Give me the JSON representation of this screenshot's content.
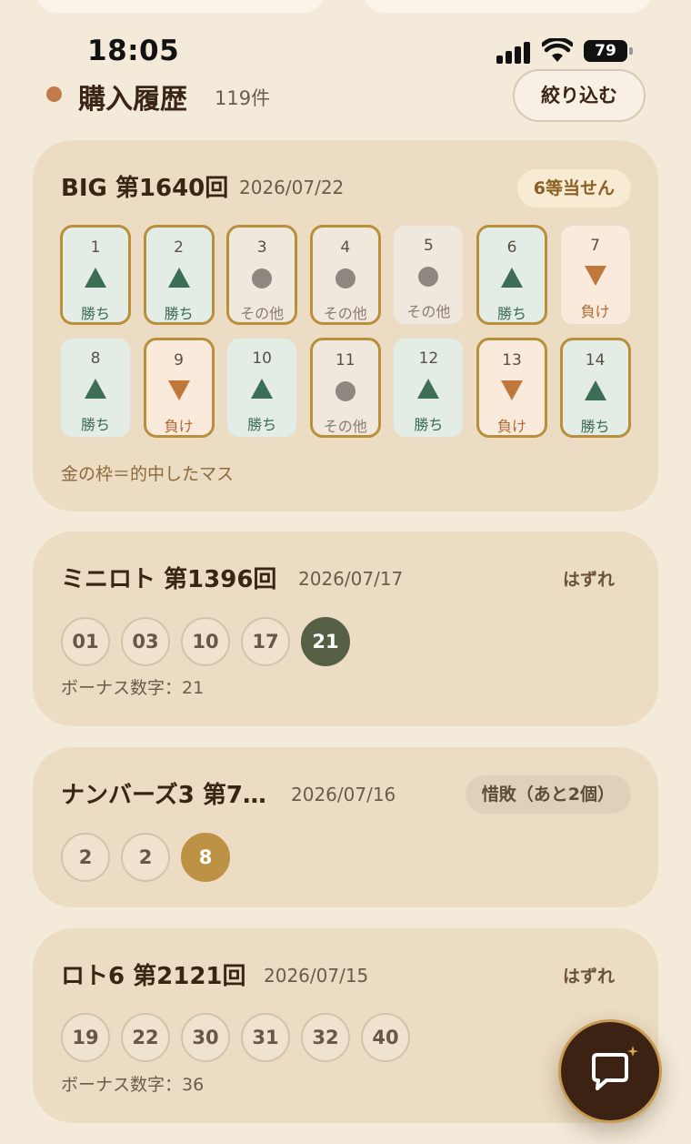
{
  "status_bar": {
    "time": "18:05",
    "battery": "79"
  },
  "header": {
    "title": "購入履歴",
    "count": "119件",
    "filter_label": "絞り込む"
  },
  "cards": [
    {
      "title": "BIG 第1640回",
      "date": "2026/07/22",
      "result": "6等当せん",
      "matches": [
        {
          "n": "1",
          "label": "勝ち",
          "kind": "win",
          "hit": true
        },
        {
          "n": "2",
          "label": "勝ち",
          "kind": "win",
          "hit": true
        },
        {
          "n": "3",
          "label": "その他",
          "kind": "other",
          "hit": true
        },
        {
          "n": "4",
          "label": "その他",
          "kind": "other",
          "hit": true
        },
        {
          "n": "5",
          "label": "その他",
          "kind": "other",
          "hit": false
        },
        {
          "n": "6",
          "label": "勝ち",
          "kind": "win",
          "hit": true
        },
        {
          "n": "7",
          "label": "負け",
          "kind": "lose",
          "hit": false
        },
        {
          "n": "8",
          "label": "勝ち",
          "kind": "win",
          "hit": false
        },
        {
          "n": "9",
          "label": "負け",
          "kind": "lose",
          "hit": true
        },
        {
          "n": "10",
          "label": "勝ち",
          "kind": "win",
          "hit": false
        },
        {
          "n": "11",
          "label": "その他",
          "kind": "other",
          "hit": true
        },
        {
          "n": "12",
          "label": "勝ち",
          "kind": "win",
          "hit": false
        },
        {
          "n": "13",
          "label": "負け",
          "kind": "lose",
          "hit": true
        },
        {
          "n": "14",
          "label": "勝ち",
          "kind": "win",
          "hit": true
        }
      ],
      "legend": "金の枠＝的中したマス"
    },
    {
      "title": "ミニロト 第1396回",
      "date": "2026/07/17",
      "result": "はずれ",
      "numbers": [
        "01",
        "03",
        "10",
        "17",
        "21"
      ],
      "bonus_text": "ボーナス数字：21"
    },
    {
      "title": "ナンバーズ3 第7…",
      "date": "2026/07/16",
      "result": "惜敗（あと2個）",
      "numbers": [
        "2",
        "2",
        "8"
      ]
    },
    {
      "title": "ロト6 第2121回",
      "date": "2026/07/15",
      "result": "はずれ",
      "numbers": [
        "19",
        "22",
        "30",
        "31",
        "32",
        "40"
      ],
      "bonus_text": "ボーナス数字：36"
    }
  ]
}
